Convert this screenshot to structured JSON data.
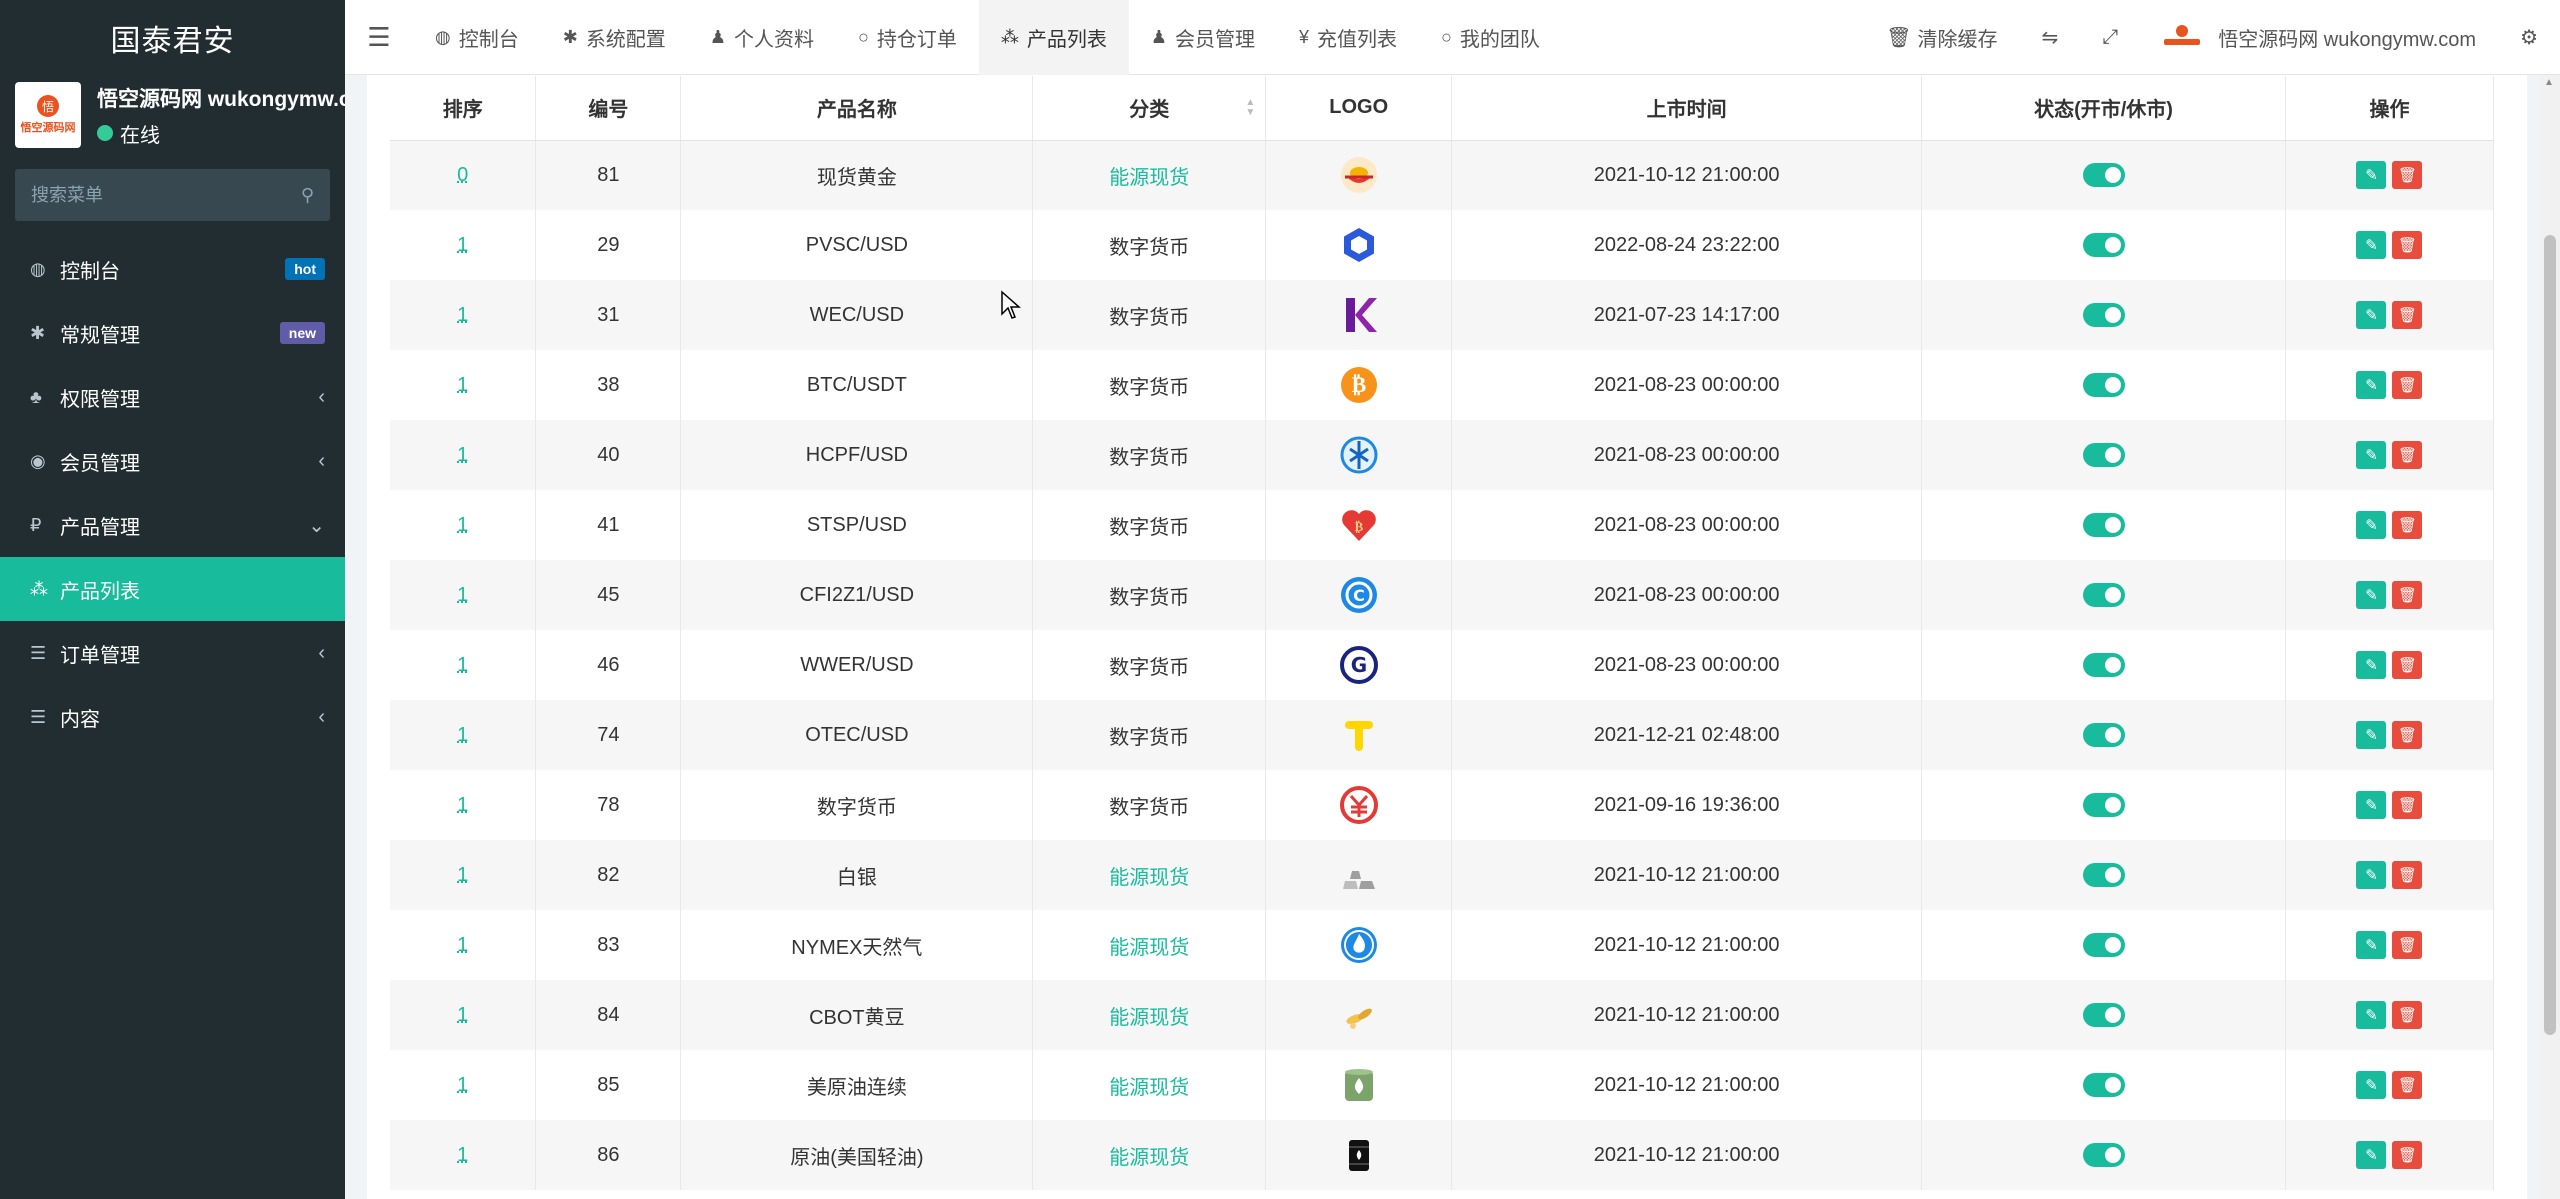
{
  "sidebar": {
    "brand": "国泰君安",
    "user": {
      "avatar_text": "悟空源码网",
      "avatar_mark": "悟",
      "name": "悟空源码网 wukongymw.com",
      "status": "在线"
    },
    "search_placeholder": "搜索菜单",
    "items": [
      {
        "icon": "dashboard-icon",
        "label": "控制台",
        "badge": "hot"
      },
      {
        "icon": "cogs-icon",
        "label": "常规管理",
        "badge": "new"
      },
      {
        "icon": "users-icon",
        "label": "权限管理",
        "chevron": "‹"
      },
      {
        "icon": "user-circle-icon",
        "label": "会员管理",
        "chevron": "‹"
      },
      {
        "icon": "ruble-icon",
        "label": "产品管理",
        "chevron": "⌄"
      },
      {
        "icon": "cubes-icon",
        "label": "产品列表",
        "active": true
      },
      {
        "icon": "list-icon",
        "label": "订单管理",
        "chevron": "‹"
      },
      {
        "icon": "list-icon",
        "label": "内容",
        "chevron": "‹"
      }
    ]
  },
  "navbar": {
    "tabs": [
      {
        "icon": "dashboard-icon",
        "glyph": "◍",
        "label": "控制台"
      },
      {
        "icon": "cog-icon",
        "glyph": "✱",
        "label": "系统配置"
      },
      {
        "icon": "user-icon",
        "glyph": "♟",
        "label": "个人资料"
      },
      {
        "icon": "circle-icon",
        "glyph": "○",
        "label": "持仓订单"
      },
      {
        "icon": "cubes-icon",
        "glyph": "⁂",
        "label": "产品列表",
        "active": true
      },
      {
        "icon": "user-icon",
        "glyph": "♟",
        "label": "会员管理"
      },
      {
        "icon": "yen-icon",
        "glyph": "¥",
        "label": "充值列表"
      },
      {
        "icon": "circle-icon",
        "glyph": "○",
        "label": "我的团队"
      }
    ],
    "clear_cache": "清除缓存",
    "user_name": "悟空源码网 wukongymw.com"
  },
  "table": {
    "headers": [
      "排序",
      "编号",
      "产品名称",
      "分类",
      "LOGO",
      "上市时间",
      "状态(开市/休市)",
      "操作"
    ],
    "rows": [
      {
        "sort": "0",
        "id": "81",
        "name": "现货黄金",
        "category": "能源现货",
        "logo": "gold-ingot-icon",
        "time": "2021-10-12 21:00:00"
      },
      {
        "sort": "1",
        "id": "29",
        "name": "PVSC/USD",
        "category": "数字货币",
        "logo": "hexagon-icon",
        "time": "2022-08-24 23:22:00"
      },
      {
        "sort": "1",
        "id": "31",
        "name": "WEC/USD",
        "category": "数字货币",
        "logo": "k-letter-icon",
        "time": "2021-07-23 14:17:00"
      },
      {
        "sort": "1",
        "id": "38",
        "name": "BTC/USDT",
        "category": "数字货币",
        "logo": "bitcoin-icon",
        "time": "2021-08-23 00:00:00"
      },
      {
        "sort": "1",
        "id": "40",
        "name": "HCPF/USD",
        "category": "数字货币",
        "logo": "ai-knot-icon",
        "time": "2021-08-23 00:00:00"
      },
      {
        "sort": "1",
        "id": "41",
        "name": "STSP/USD",
        "category": "数字货币",
        "logo": "heart-bitcoin-icon",
        "time": "2021-08-23 00:00:00"
      },
      {
        "sort": "1",
        "id": "45",
        "name": "CFI2Z1/USD",
        "category": "数字货币",
        "logo": "c-coin-icon",
        "time": "2021-08-23 00:00:00"
      },
      {
        "sort": "1",
        "id": "46",
        "name": "WWER/USD",
        "category": "数字货币",
        "logo": "g-coin-icon",
        "time": "2021-08-23 00:00:00"
      },
      {
        "sort": "1",
        "id": "74",
        "name": "OTEC/USD",
        "category": "数字货币",
        "logo": "t-letter-icon",
        "time": "2021-12-21 02:48:00"
      },
      {
        "sort": "1",
        "id": "78",
        "name": "数字货币",
        "category": "数字货币",
        "logo": "yuan-coin-icon",
        "time": "2021-09-16 19:36:00"
      },
      {
        "sort": "1",
        "id": "82",
        "name": "白银",
        "category": "能源现货",
        "logo": "silver-bars-icon",
        "time": "2021-10-12 21:00:00"
      },
      {
        "sort": "1",
        "id": "83",
        "name": "NYMEX天然气",
        "category": "能源现货",
        "logo": "flame-icon",
        "time": "2021-10-12 21:00:00"
      },
      {
        "sort": "1",
        "id": "84",
        "name": "CBOT黄豆",
        "category": "能源现货",
        "logo": "soybean-icon",
        "time": "2021-10-12 21:00:00"
      },
      {
        "sort": "1",
        "id": "85",
        "name": "美原油连续",
        "category": "能源现货",
        "logo": "oil-drum-icon",
        "time": "2021-10-12 21:00:00"
      },
      {
        "sort": "1",
        "id": "86",
        "name": "原油(美国轻油)",
        "category": "能源现货",
        "logo": "oil-barrel-icon",
        "time": "2021-10-12 21:00:00"
      }
    ],
    "status_on": true
  },
  "colors": {
    "accent": "#18bc9c",
    "danger": "#e74c3c",
    "sidebar_bg": "#222d32"
  }
}
